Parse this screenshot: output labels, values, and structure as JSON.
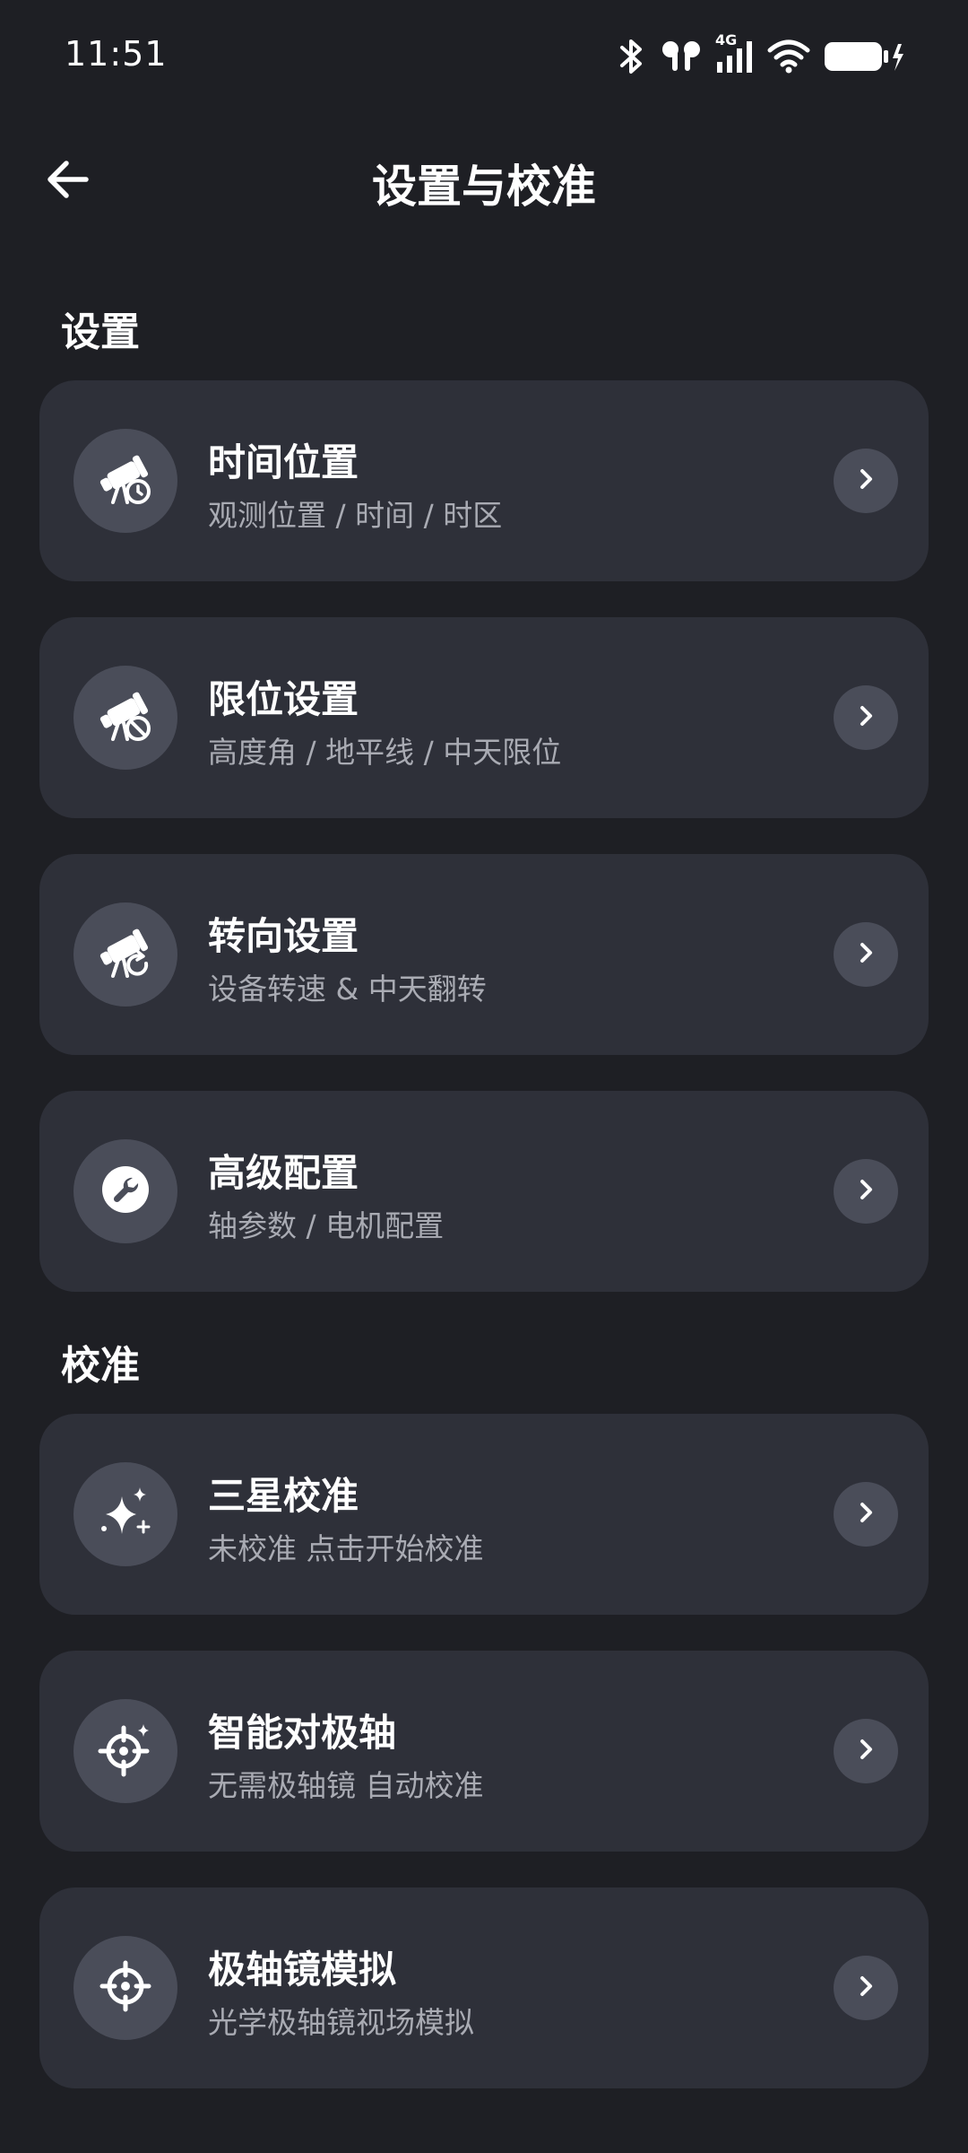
{
  "status_bar": {
    "time": "11:51",
    "icons": [
      "bluetooth-icon",
      "earbuds-icon",
      "cellular-4g-icon",
      "wifi-icon",
      "battery-charging-icon"
    ],
    "network_label": "4G"
  },
  "header": {
    "title": "设置与校准",
    "back_icon": "arrow-left-icon"
  },
  "sections": [
    {
      "title": "设置",
      "items": [
        {
          "title": "时间位置",
          "subtitle": "观测位置 / 时间 / 时区",
          "icon": "telescope-clock-icon"
        },
        {
          "title": "限位设置",
          "subtitle": "高度角 / 地平线 / 中天限位",
          "icon": "telescope-limit-icon"
        },
        {
          "title": "转向设置",
          "subtitle": "设备转速 & 中天翻转",
          "icon": "telescope-rotate-icon"
        },
        {
          "title": "高级配置",
          "subtitle": "轴参数 / 电机配置",
          "icon": "wrench-icon"
        }
      ]
    },
    {
      "title": "校准",
      "items": [
        {
          "title": "三星校准",
          "subtitle": "未校准 点击开始校准",
          "icon": "sparkle-stars-icon"
        },
        {
          "title": "智能对极轴",
          "subtitle": "无需极轴镜 自动校准",
          "icon": "crosshair-sparkle-icon"
        },
        {
          "title": "极轴镜模拟",
          "subtitle": "光学极轴镜视场模拟",
          "icon": "crosshair-icon"
        }
      ]
    }
  ],
  "colors": {
    "background": "#1e1f24",
    "card": "#2e3039",
    "icon_circle": "#4a4d59",
    "subtitle": "#a9abb3"
  }
}
